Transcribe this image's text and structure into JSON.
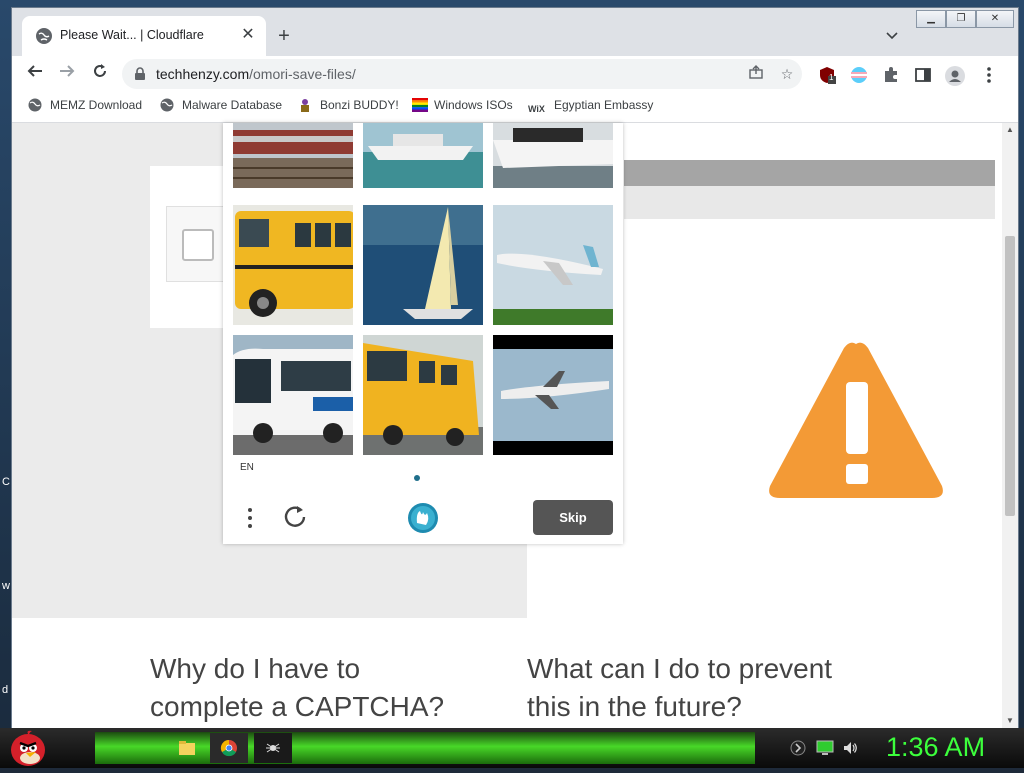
{
  "desktop": {
    "left_edge_chars": [
      "C",
      "w",
      "d"
    ]
  },
  "browser": {
    "tab": {
      "title": "Please Wait... | Cloudflare",
      "close_icon": "close-icon"
    },
    "new_tab_symbol": "+",
    "tab_list_symbol": "⌄",
    "window_controls": [
      "minimize",
      "restore",
      "close"
    ],
    "nav": {
      "back": "←",
      "forward": "→",
      "reload": "↻"
    },
    "address": {
      "host": "techhenzy.com",
      "path": "/omori-save-files/"
    },
    "extension_badge": "1",
    "bookmarks": [
      {
        "label": "MEMZ Download",
        "icon": "globe-icon"
      },
      {
        "label": "Malware Database",
        "icon": "globe-icon"
      },
      {
        "label": "Bonzi BUDDY!",
        "icon": "bonzi-icon"
      },
      {
        "label": "Windows ISOs",
        "icon": "rainbow-flag-icon"
      },
      {
        "label": "Egyptian Embassy",
        "icon": "wix-icon"
      }
    ],
    "wix_icon_text": "WiX"
  },
  "page": {
    "faq": [
      {
        "title": "Why do I have to complete a CAPTCHA?"
      },
      {
        "title": "What can I do to prevent this in the future?"
      }
    ],
    "warning_color": "#f39a36"
  },
  "captcha": {
    "language": "EN",
    "skip_label": "Skip",
    "tiles": [
      "train",
      "boat",
      "yacht",
      "school-bus",
      "sailboat",
      "airplane",
      "city-bus",
      "school-bus",
      "airplane"
    ]
  },
  "taskbar": {
    "clock": "1:36 AM"
  }
}
